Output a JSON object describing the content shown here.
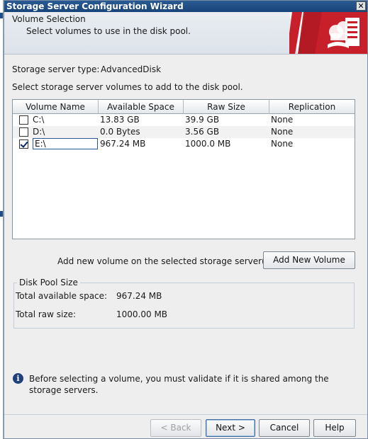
{
  "window": {
    "title": "Storage Server Configuration Wizard",
    "close_glyph": "✕"
  },
  "header": {
    "title": "Volume Selection",
    "subtitle": "Select volumes to use in the disk pool."
  },
  "server_type": {
    "label": "Storage server type:",
    "value": "AdvancedDisk"
  },
  "instruction": "Select storage server volumes to add to the disk pool.",
  "table": {
    "columns": [
      "Volume Name",
      "Available Space",
      "Raw Size",
      "Replication"
    ],
    "rows": [
      {
        "name": "C:\\",
        "available": "13.83 GB",
        "raw": "39.9 GB",
        "replication": "None",
        "checked": false
      },
      {
        "name": "D:\\",
        "available": "0.0 Bytes",
        "raw": "3.56 GB",
        "replication": "None",
        "checked": false
      },
      {
        "name": "E:\\",
        "available": "967.24 MB",
        "raw": "1000.0 MB",
        "replication": "None",
        "checked": true
      }
    ]
  },
  "add_volume": {
    "label": "Add new volume on the selected storage server(s)",
    "button": "Add New Volume"
  },
  "disk_pool": {
    "title": "Disk Pool Size",
    "total_available_label": "Total available space:",
    "total_available_value": "967.24 MB",
    "total_raw_label": "Total raw size:",
    "total_raw_value": "1000.00 MB"
  },
  "info": {
    "icon_glyph": "i",
    "text": "Before selecting a volume, you must validate if it is shared among the storage servers."
  },
  "buttons": {
    "back": "< Back",
    "next": "Next >",
    "cancel": "Cancel",
    "help": "Help"
  },
  "colors": {
    "titlebar": "#18457a",
    "brand_red": "#c8202a",
    "accent_blue": "#3b6aa0"
  }
}
